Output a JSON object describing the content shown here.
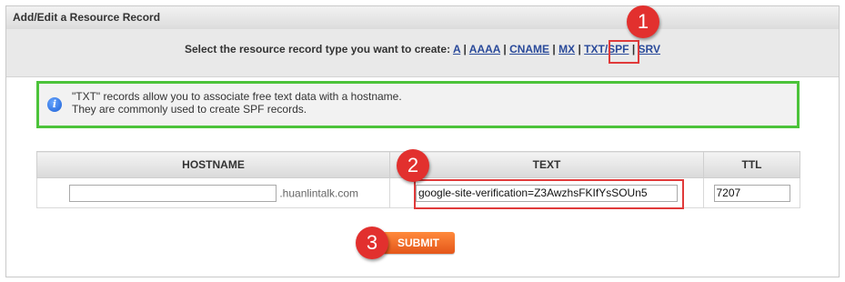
{
  "panel": {
    "title": "Add/Edit a Resource Record"
  },
  "type_select": {
    "prompt": "Select the resource record type you want to create:",
    "types": [
      "A",
      "AAAA",
      "CNAME",
      "MX",
      "TXT/SPF",
      "SRV"
    ],
    "separator": "|",
    "selected": "TXT/SPF"
  },
  "info": {
    "line1": "\"TXT\" records allow you to associate free text data with a hostname.",
    "line2": "They are commonly used to create SPF records.",
    "icon": "info-icon"
  },
  "table": {
    "headers": {
      "hostname": "HOSTNAME",
      "text": "TEXT",
      "ttl": "TTL"
    },
    "hostname_value": "",
    "hostname_suffix": ".huanlintalk.com",
    "text_value": "google-site-verification=Z3AwzhsFKIfYsSOUn5",
    "ttl_value": "7207"
  },
  "submit": {
    "label": "SUBMIT"
  },
  "callouts": [
    "1",
    "2",
    "3"
  ],
  "colors": {
    "accent": "#e2302e",
    "info_border": "#4cc33a",
    "submit": "#f26a22",
    "link": "#2a4a9a"
  }
}
